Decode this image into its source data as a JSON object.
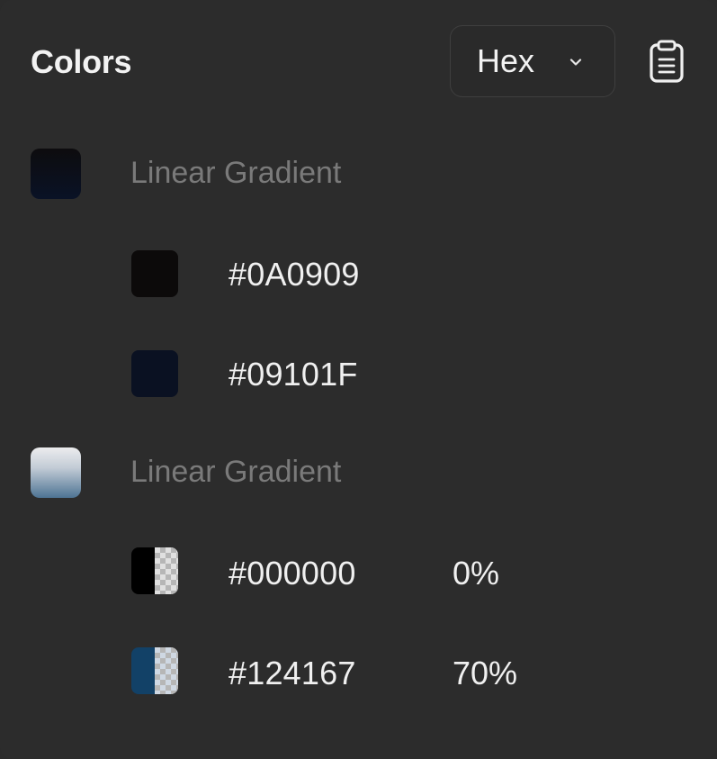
{
  "header": {
    "title": "Colors",
    "format_select": {
      "value": "Hex"
    },
    "icons": {
      "chevron": "chevron-down-icon",
      "clipboard": "clipboard-icon"
    }
  },
  "groups": [
    {
      "label": "Linear Gradient",
      "preview": {
        "from": "#0A0909",
        "to": "#09101F"
      },
      "stops": [
        {
          "hex": "#0A0909",
          "color": "#0A0909",
          "percent": ""
        },
        {
          "hex": "#09101F",
          "color": "#09101F",
          "percent": ""
        }
      ]
    },
    {
      "label": "Linear Gradient",
      "preview": {
        "from": "#e8e8ea",
        "to": "#4a7190"
      },
      "stops": [
        {
          "hex": "#000000",
          "color": "#000000",
          "percent": "0%"
        },
        {
          "hex": "#124167",
          "color": "#124167",
          "percent": "70%"
        }
      ]
    }
  ]
}
